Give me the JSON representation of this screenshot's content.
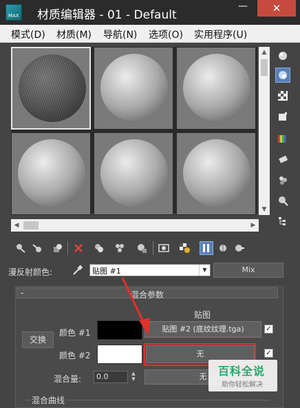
{
  "window": {
    "title": "材质编辑器 - 01 - Default",
    "app_icon_text": "MAX",
    "minimize_glyph": "—",
    "close_glyph": "✕"
  },
  "menu": {
    "items": [
      "模式(D)",
      "材质(M)",
      "导航(N)",
      "选项(O)",
      "实用程序(U)"
    ]
  },
  "sample_slots": {
    "count": 6,
    "active_index": 0,
    "active_has_texture": true
  },
  "right_toolbar": {
    "icons": [
      "sample-type-sphere-icon",
      "backlight-icon",
      "background-checker-icon",
      "uv-tiling-icon",
      "video-color-check-icon",
      "make-preview-icon",
      "options-icon",
      "select-by-material-icon",
      "material-map-navigator-icon"
    ],
    "active_index": 1
  },
  "bottom_toolbar": {
    "icons": [
      "get-material-icon",
      "put-to-scene-icon",
      "assign-to-selection-icon",
      "reset-map-icon",
      "copy-material-icon",
      "make-unique-icon",
      "put-to-library-icon",
      "material-id-channel-icon",
      "show-shaded-in-viewport-icon",
      "show-end-result-icon",
      "go-to-parent-icon",
      "go-forward-to-sibling-icon"
    ],
    "active_index": 9
  },
  "diffuse": {
    "label": "漫反射颜色:",
    "map_name": "贴图 #1",
    "type_button": "Mix"
  },
  "rollout": {
    "collapse_glyph": "-",
    "title": "混合参数",
    "map_header": "贴图",
    "swap_button": "交换",
    "color1_label": "颜色 #1",
    "color1_hex": "#000000",
    "color1_map": "贴图 #2 (底纹纹理.tga)",
    "color1_checked": true,
    "color2_label": "颜色 #2",
    "color2_hex": "#ffffff",
    "color2_map": "无",
    "color2_checked": true,
    "mix_amount_label": "混合量:",
    "mix_amount_value": "0.0",
    "mix_map": "无",
    "mix_curve_label": "混合曲线"
  },
  "annotation": {
    "highlight_color": "#e2302a"
  },
  "watermark": {
    "main": "百科全说",
    "sub": "助你轻松解决"
  }
}
